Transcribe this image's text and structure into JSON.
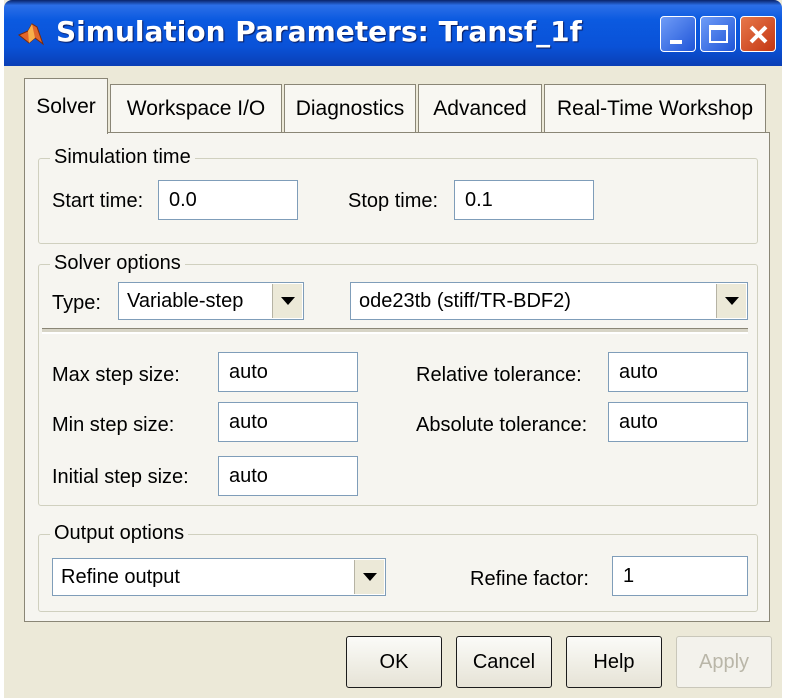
{
  "window": {
    "title": "Simulation Parameters: Transf_1f"
  },
  "tabs": [
    "Solver",
    "Workspace I/O",
    "Diagnostics",
    "Advanced",
    "Real-Time Workshop"
  ],
  "simulation_time": {
    "group_label": "Simulation time",
    "start_label": "Start time:",
    "start_value": "0.0",
    "stop_label": "Stop time:",
    "stop_value": "0.1"
  },
  "solver_options": {
    "group_label": "Solver options",
    "type_label": "Type:",
    "type_value": "Variable-step",
    "solver_value": "ode23tb (stiff/TR-BDF2)",
    "max_step_label": "Max step size:",
    "max_step_value": "auto",
    "min_step_label": "Min step size:",
    "min_step_value": "auto",
    "initial_step_label": "Initial step size:",
    "initial_step_value": "auto",
    "rel_tol_label": "Relative tolerance:",
    "rel_tol_value": "auto",
    "abs_tol_label": "Absolute tolerance:",
    "abs_tol_value": "auto"
  },
  "output_options": {
    "group_label": "Output options",
    "output_value": "Refine output",
    "refine_label": "Refine factor:",
    "refine_value": "1"
  },
  "buttons": {
    "ok": "OK",
    "cancel": "Cancel",
    "help": "Help",
    "apply": "Apply"
  },
  "icons": {
    "app": "matlab-logo-icon",
    "minimize": "minimize-icon",
    "maximize": "maximize-icon",
    "close": "close-icon",
    "dropdown": "chevron-down-icon"
  },
  "colors": {
    "titlebar": "#0a52d8",
    "dialog_bg": "#ece9d8",
    "close_button": "#c43613",
    "field_border": "#7f9db9"
  }
}
